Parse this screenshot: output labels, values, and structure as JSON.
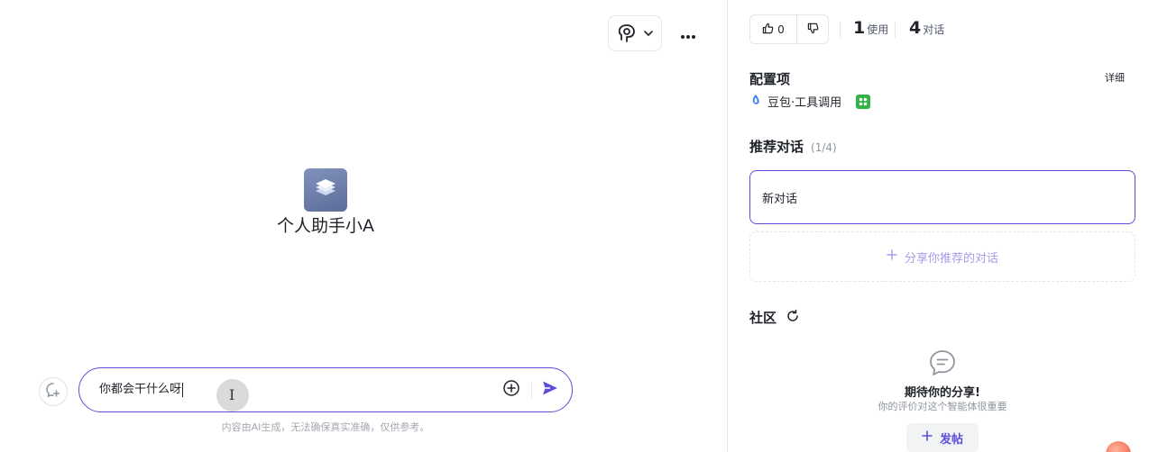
{
  "bot": {
    "name": "个人助手小A"
  },
  "input": {
    "value": "你都会干什么呀"
  },
  "disclaimer": "内容由AI生成，无法确保真实准确，仅供参考。",
  "stats": {
    "likes": "0",
    "uses_num": "1",
    "uses_label": "使用",
    "chats_num": "4",
    "chats_label": "对话"
  },
  "config": {
    "title": "配置项",
    "detail_label": "详细",
    "model": "豆包·工具调用"
  },
  "recommended": {
    "title": "推荐对话",
    "count": "(1/4)",
    "items": [
      "新对话"
    ],
    "share_label": "分享你推荐的对话"
  },
  "community": {
    "title": "社区",
    "empty_title": "期待你的分享!",
    "empty_sub": "你的评价对这个智能体很重要",
    "post_label": "发帖"
  },
  "colors": {
    "accent": "#5b4fd8",
    "plugin_green": "#2fb344"
  },
  "icons": [
    "agent-mode-icon",
    "chevron-down-icon",
    "more-icon",
    "new-topic-icon",
    "plus-circle-icon",
    "send-icon",
    "thumb-up-icon",
    "thumb-down-icon",
    "doubao-logo-icon",
    "plugin-icon",
    "plus-icon",
    "refresh-icon",
    "chat-bubble-icon"
  ]
}
